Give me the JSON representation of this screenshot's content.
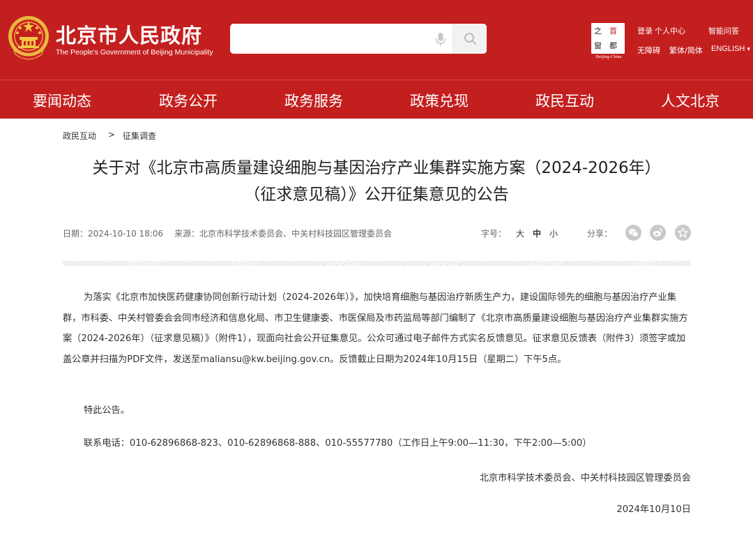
{
  "header": {
    "title": "北京市人民政府",
    "subtitle": "The People's Government of Beijing Municipality",
    "search": {
      "placeholder": "",
      "value": ""
    },
    "capital_logo": {
      "chars": [
        "之",
        "首",
        "窗",
        "都"
      ],
      "en": "Beijing-China"
    },
    "links": {
      "login": "登录",
      "personal_center": "个人中心",
      "smart_qa": "智能问答",
      "accessibility": "无障碍",
      "simplified_traditional": "繁体/简体",
      "english": "ENGLISH",
      "english_arrow": "▾"
    }
  },
  "nav": {
    "items": [
      {
        "label": "要闻动态"
      },
      {
        "label": "政务公开"
      },
      {
        "label": "政务服务"
      },
      {
        "label": "政策兑现"
      },
      {
        "label": "政民互动"
      },
      {
        "label": "人文北京"
      }
    ]
  },
  "breadcrumb": {
    "items": [
      "政民互动",
      "征集调查"
    ],
    "separator": ">"
  },
  "article": {
    "title_line1": "关于对《北京市高质量建设细胞与基因治疗产业集群实施方案（2024-2026年）",
    "title_line2": "（征求意见稿）》公开征集意见的公告",
    "meta": {
      "date": "日期：2024-10-10 18:06",
      "source": "来源：北京市科学技术委员会、中关村科技园区管理委员会",
      "font_size_label": "字号：",
      "font_sizes": [
        "大",
        "中",
        "小"
      ],
      "share_label": "分享："
    },
    "body": {
      "p1": "为落实《北京市加快医药健康协同创新行动计划（2024-2026年）》，加快培育细胞与基因治疗新质生产力，建设国际领先的细胞与基因治疗产业集群，市科委、中关村管委会会同市经济和信息化局、市卫生健康委、市医保局及市药监局等部门编制了《北京市高质量建设细胞与基因治疗产业集群实施方案（2024-2026年）（征求意见稿）》（附件1），现面向社会公开征集意见。公众可通过电子邮件方式实名反馈意见。征求意见反馈表（附件3）须签字或加盖公章并扫描为PDF文件，发送至maliansu@kw.beijing.gov.cn。反馈截止日期为2024年10月15日（星期二）下午5点。",
      "p2": "特此公告。",
      "p3": "联系电话：010-62896868-823、010-62896868-888、010-55577780（工作日上午9:00—11:30，下午2:00—5:00）",
      "signature": "北京市科学技术委员会、中关村科技园区管理委员会",
      "sign_date": "2024年10月10日"
    }
  },
  "colors": {
    "brand_red": "#c41f1f",
    "share_icon_gray": "#c9c9c9"
  }
}
